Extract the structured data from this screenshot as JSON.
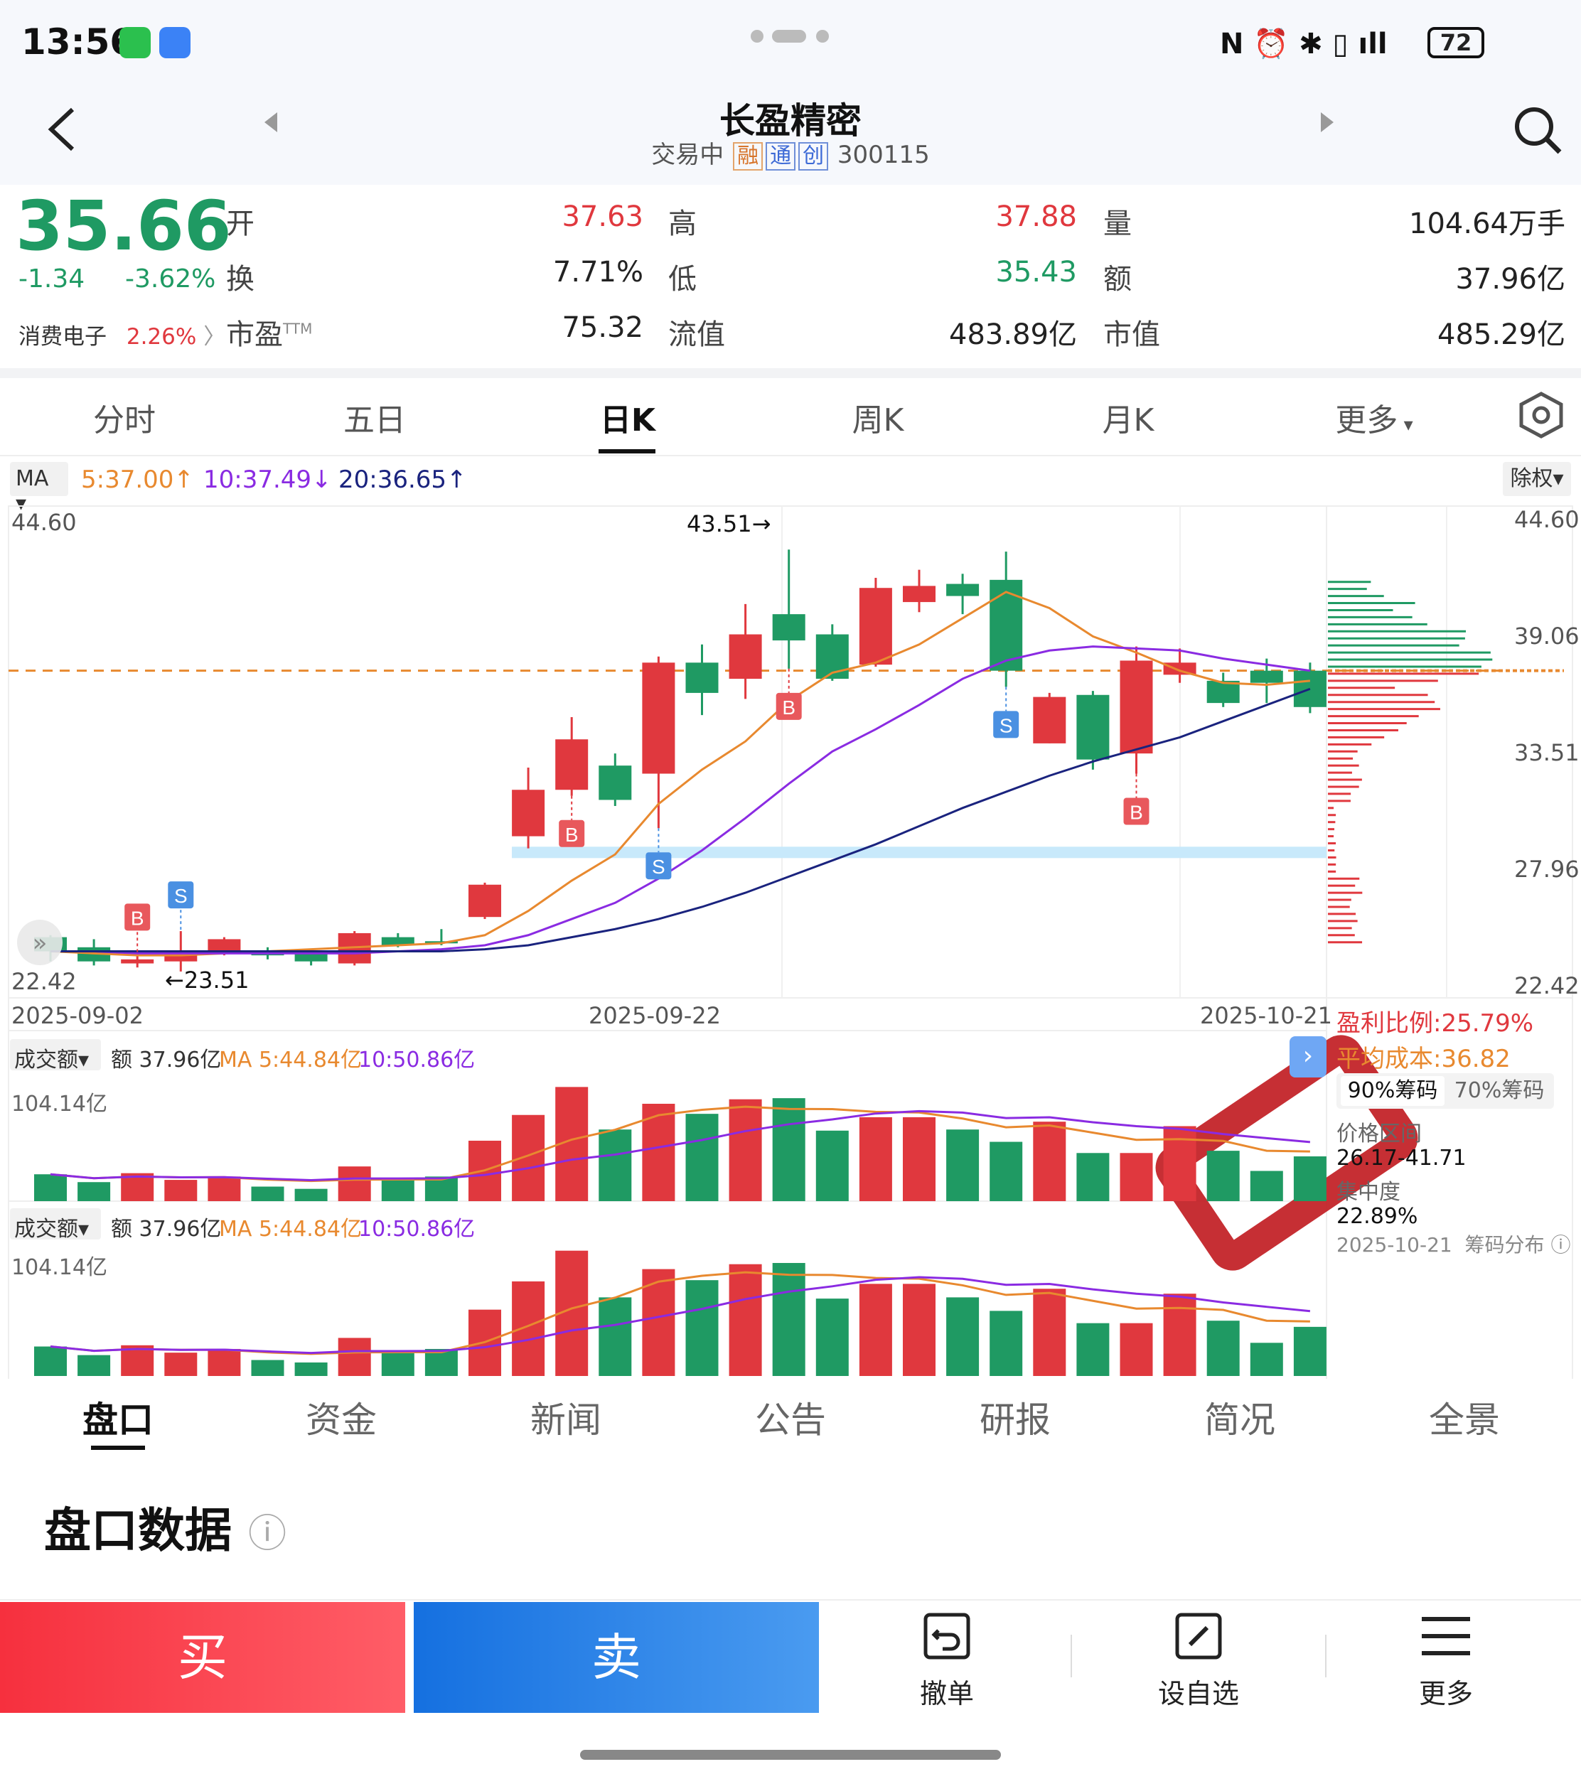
{
  "status": {
    "time": "13:56",
    "battery": "72"
  },
  "header": {
    "title": "长盈精密",
    "trade_status": "交易中",
    "tags": [
      "融",
      "通",
      "创"
    ],
    "code": "300115"
  },
  "quote": {
    "price": "35.66",
    "change": "-1.34",
    "change_pct": "-3.62%",
    "sector_name": "消费电子",
    "sector_pct": "2.26%",
    "open_label": "开",
    "open": "37.63",
    "high_label": "高",
    "high": "37.88",
    "volume_label": "量",
    "volume": "104.64万手",
    "turnover_label": "换",
    "turnover": "7.71%",
    "low_label": "低",
    "low": "35.43",
    "amount_label": "额",
    "amount": "37.96亿",
    "pe_label": "市盈",
    "pe_sup": "TTM",
    "pe": "75.32",
    "float_cap_label": "流值",
    "float_cap": "483.89亿",
    "mkt_cap_label": "市值",
    "mkt_cap": "485.29亿"
  },
  "period_tabs": [
    "分时",
    "五日",
    "日K",
    "周K",
    "月K",
    "更多"
  ],
  "period_active": "日K",
  "ma": {
    "label": "MA",
    "ma5": "5:37.00",
    "ma10": "10:37.49",
    "ma20": "20:36.65",
    "adjust": "除权"
  },
  "kline": {
    "y_top": "44.60",
    "y_bottom": "22.42",
    "right_ticks": [
      "44.60",
      "39.06",
      "33.51",
      "27.96",
      "22.42"
    ],
    "high_mark": "43.51→",
    "low_mark": "←23.51",
    "dates": [
      "2025-09-02",
      "2025-09-22",
      "2025-10-21"
    ],
    "ymin": 22.42,
    "ymax": 44.6,
    "candles": [
      {
        "o": 24.3,
        "c": 23.6,
        "h": 24.4,
        "l": 23.1,
        "t": "d"
      },
      {
        "o": 23.8,
        "c": 23.1,
        "h": 24.2,
        "l": 22.9,
        "t": "d"
      },
      {
        "o": 23.0,
        "c": 23.2,
        "h": 23.5,
        "l": 22.8,
        "t": "u"
      },
      {
        "o": 23.1,
        "c": 23.6,
        "h": 24.6,
        "l": 22.6,
        "t": "u"
      },
      {
        "o": 23.5,
        "c": 24.2,
        "h": 24.3,
        "l": 23.4,
        "t": "u"
      },
      {
        "o": 23.6,
        "c": 23.4,
        "h": 23.8,
        "l": 23.2,
        "t": "d"
      },
      {
        "o": 23.5,
        "c": 23.1,
        "h": 23.6,
        "l": 22.9,
        "t": "d"
      },
      {
        "o": 23.0,
        "c": 24.5,
        "h": 24.6,
        "l": 22.9,
        "t": "u"
      },
      {
        "o": 24.3,
        "c": 23.9,
        "h": 24.5,
        "l": 23.8,
        "t": "d"
      },
      {
        "o": 24.0,
        "c": 24.1,
        "h": 24.7,
        "l": 23.9,
        "t": "d"
      },
      {
        "o": 25.3,
        "c": 26.9,
        "h": 27.0,
        "l": 25.2,
        "t": "u"
      },
      {
        "o": 29.3,
        "c": 31.6,
        "h": 32.7,
        "l": 28.7,
        "t": "u"
      },
      {
        "o": 31.6,
        "c": 34.1,
        "h": 35.2,
        "l": 31.3,
        "t": "u"
      },
      {
        "o": 32.8,
        "c": 31.1,
        "h": 33.4,
        "l": 30.8,
        "t": "d"
      },
      {
        "o": 32.4,
        "c": 37.9,
        "h": 38.2,
        "l": 29.7,
        "t": "u"
      },
      {
        "o": 37.9,
        "c": 36.4,
        "h": 38.8,
        "l": 35.3,
        "t": "d"
      },
      {
        "o": 37.1,
        "c": 39.3,
        "h": 40.8,
        "l": 36.1,
        "t": "u"
      },
      {
        "o": 40.3,
        "c": 39.0,
        "h": 43.5,
        "l": 37.6,
        "t": "d"
      },
      {
        "o": 39.3,
        "c": 37.1,
        "h": 39.8,
        "l": 37.0,
        "t": "d"
      },
      {
        "o": 37.8,
        "c": 41.6,
        "h": 42.1,
        "l": 37.7,
        "t": "u"
      },
      {
        "o": 40.9,
        "c": 41.7,
        "h": 42.5,
        "l": 40.4,
        "t": "u"
      },
      {
        "o": 41.8,
        "c": 41.2,
        "h": 42.3,
        "l": 40.3,
        "t": "d"
      },
      {
        "o": 42.0,
        "c": 37.5,
        "h": 43.4,
        "l": 36.7,
        "t": "d"
      },
      {
        "o": 33.9,
        "c": 36.2,
        "h": 36.4,
        "l": 33.9,
        "t": "u"
      },
      {
        "o": 36.3,
        "c": 33.1,
        "h": 36.5,
        "l": 32.6,
        "t": "d"
      },
      {
        "o": 33.4,
        "c": 38.0,
        "h": 38.7,
        "l": 32.4,
        "t": "u"
      },
      {
        "o": 37.9,
        "c": 37.3,
        "h": 38.6,
        "l": 36.9,
        "t": "u"
      },
      {
        "o": 37.0,
        "c": 35.9,
        "h": 37.4,
        "l": 35.7,
        "t": "d"
      },
      {
        "o": 36.9,
        "c": 37.5,
        "h": 38.1,
        "l": 35.9,
        "t": "d"
      },
      {
        "o": 37.5,
        "c": 35.7,
        "h": 37.9,
        "l": 35.4,
        "t": "d"
      }
    ],
    "ma5_line": [
      23.6,
      23.5,
      23.4,
      23.4,
      23.5,
      23.6,
      23.7,
      23.8,
      23.9,
      24.0,
      24.4,
      25.6,
      27.1,
      28.4,
      30.9,
      32.6,
      34.0,
      36.0,
      37.4,
      37.9,
      38.8,
      40.1,
      41.4,
      40.6,
      39.2,
      38.4,
      37.5,
      36.9,
      36.8,
      37.0
    ],
    "ma10_line": [
      23.6,
      23.6,
      23.5,
      23.5,
      23.5,
      23.5,
      23.5,
      23.5,
      23.6,
      23.7,
      23.9,
      24.4,
      25.2,
      26.0,
      27.2,
      28.6,
      30.2,
      31.9,
      33.5,
      34.6,
      35.8,
      37.1,
      38.0,
      38.5,
      38.7,
      38.6,
      38.5,
      38.1,
      37.8,
      37.5
    ],
    "ma20_line": [
      23.6,
      23.6,
      23.6,
      23.6,
      23.6,
      23.6,
      23.6,
      23.6,
      23.6,
      23.6,
      23.7,
      23.9,
      24.3,
      24.7,
      25.2,
      25.8,
      26.5,
      27.3,
      28.1,
      28.9,
      29.8,
      30.7,
      31.5,
      32.3,
      33.0,
      33.6,
      34.2,
      35.0,
      35.8,
      36.6
    ],
    "signals": [
      {
        "label": "B",
        "i": 2,
        "above": true
      },
      {
        "label": "S",
        "i": 3,
        "above": true
      },
      {
        "label": "B",
        "i": 12,
        "above": false
      },
      {
        "label": "S",
        "i": 14,
        "above": false
      },
      {
        "label": "B",
        "i": 17,
        "above": false
      },
      {
        "label": "S",
        "i": 22,
        "above": false
      },
      {
        "label": "B",
        "i": 25,
        "above": false
      }
    ],
    "reference_price": 37.5,
    "band_price": 28.5
  },
  "chip": {
    "profit_ratio": "盈利比例:25.79%",
    "avg_cost": "平均成本:36.82",
    "tab90": "90%筹码",
    "tab70": "70%筹码",
    "range_label": "价格区间",
    "range": "26.17-41.71",
    "concentration_label": "集中度",
    "concentration": "22.89%",
    "date": "2025-10-21",
    "dist_label": "筹码分布"
  },
  "volume1": {
    "label": "成交额",
    "amount": "额 37.96亿",
    "ma5": "MA 5:44.84亿",
    "ma10": "10:50.86亿",
    "ymax_label": "104.14亿"
  },
  "volume2": {
    "label": "成交额",
    "amount": "额 37.96亿",
    "ma5": "MA 5:44.84亿",
    "ma10": "10:50.86亿",
    "ymax_label": "104.14亿"
  },
  "volumes": [
    24,
    17,
    25,
    19,
    22,
    13,
    11,
    31,
    20,
    22,
    54,
    77,
    102,
    64,
    87,
    78,
    91,
    92,
    63,
    75,
    75,
    64,
    53,
    71,
    43,
    43,
    67,
    45,
    27,
    40,
    37
  ],
  "bottom_tabs": [
    "盘口",
    "资金",
    "新闻",
    "公告",
    "研报",
    "简况",
    "全景"
  ],
  "bottom_active": "盘口",
  "section_title": "盘口数据",
  "actions": {
    "buy": "买",
    "sell": "卖",
    "cancel": "撤单",
    "watch": "设自选",
    "more": "更多"
  },
  "colors": {
    "up": "#e0383e",
    "down": "#1f9a63",
    "ma5": "#e8892f",
    "ma10": "#8a2be2",
    "ma20": "#1a237e"
  }
}
